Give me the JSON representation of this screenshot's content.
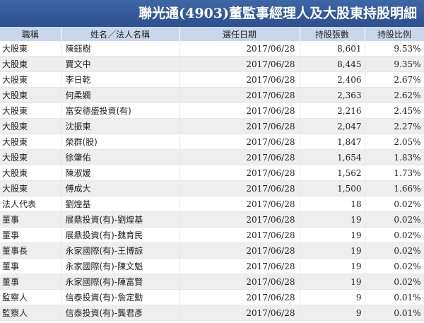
{
  "title": "聯光通(4903)董監事經理人及大股東持股明細",
  "columns": [
    "職稱",
    "姓名／法人名稱",
    "選任日期",
    "持股張數",
    "持股比例"
  ],
  "rows": [
    {
      "role": "大股東",
      "name": "陳鈺樹",
      "date": "2017/06/28",
      "shares": "8,601",
      "pct": "9.53%"
    },
    {
      "role": "大股東",
      "name": "賈文中",
      "date": "2017/06/28",
      "shares": "8,445",
      "pct": "9.35%"
    },
    {
      "role": "大股東",
      "name": "李日乾",
      "date": "2017/06/28",
      "shares": "2,406",
      "pct": "2.67%"
    },
    {
      "role": "大股東",
      "name": "何柔嫻",
      "date": "2017/06/28",
      "shares": "2,363",
      "pct": "2.62%"
    },
    {
      "role": "大股東",
      "name": "富安德盛投資(有)",
      "date": "2017/06/28",
      "shares": "2,216",
      "pct": "2.45%"
    },
    {
      "role": "大股東",
      "name": "沈振東",
      "date": "2017/06/28",
      "shares": "2,047",
      "pct": "2.27%"
    },
    {
      "role": "大股東",
      "name": "榮群(股)",
      "date": "2017/06/28",
      "shares": "1,847",
      "pct": "2.05%"
    },
    {
      "role": "大股東",
      "name": "徐肇佑",
      "date": "2017/06/28",
      "shares": "1,654",
      "pct": "1.83%"
    },
    {
      "role": "大股東",
      "name": "陳淑媛",
      "date": "2017/06/28",
      "shares": "1,562",
      "pct": "1.73%"
    },
    {
      "role": "大股東",
      "name": "傅成大",
      "date": "2017/06/28",
      "shares": "1,500",
      "pct": "1.66%"
    },
    {
      "role": "法人代表",
      "name": "劉煌基",
      "date": "2017/06/28",
      "shares": "18",
      "pct": "0.02%"
    },
    {
      "role": "董事",
      "name": "展鼎投資(有)-劉煌基",
      "date": "2017/06/28",
      "shares": "19",
      "pct": "0.02%"
    },
    {
      "role": "董事",
      "name": "展鼎投資(有)-魏育民",
      "date": "2017/06/28",
      "shares": "19",
      "pct": "0.02%"
    },
    {
      "role": "董事長",
      "name": "永家國際(有)-王博諒",
      "date": "2017/06/28",
      "shares": "19",
      "pct": "0.02%"
    },
    {
      "role": "董事",
      "name": "永家國際(有)-陳文魁",
      "date": "2017/06/28",
      "shares": "19",
      "pct": "0.02%"
    },
    {
      "role": "董事",
      "name": "永家國際(有)-陳富賢",
      "date": "2017/06/28",
      "shares": "19",
      "pct": "0.02%"
    },
    {
      "role": "監察人",
      "name": "信泰投資(有)-詹定勳",
      "date": "2017/06/28",
      "shares": "9",
      "pct": "0.01%"
    },
    {
      "role": "監察人",
      "name": "信泰投資(有)-龔君彥",
      "date": "2017/06/28",
      "shares": "9",
      "pct": "0.01%"
    }
  ]
}
